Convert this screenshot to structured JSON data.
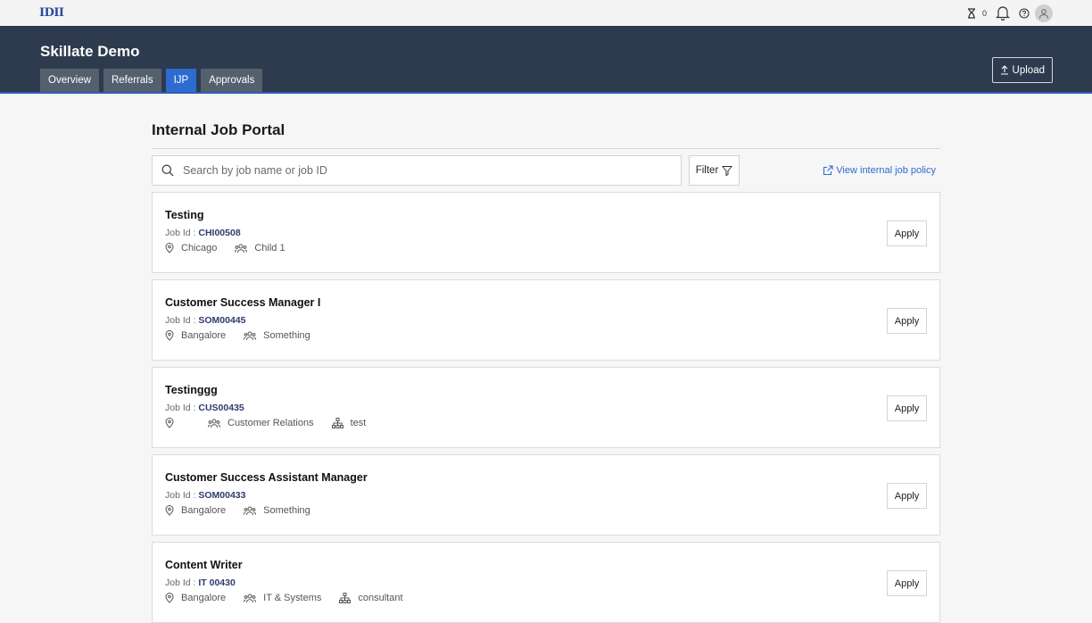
{
  "topbar": {
    "logo": "IDII",
    "pending_count": "0"
  },
  "header": {
    "title": "Skillate Demo",
    "tabs": [
      {
        "label": "Overview"
      },
      {
        "label": "Referrals"
      },
      {
        "label": "IJP"
      },
      {
        "label": "Approvals"
      }
    ],
    "upload_label": "Upload"
  },
  "main": {
    "title": "Internal Job Portal",
    "search_placeholder": "Search by job name or job ID",
    "filter_label": "Filter",
    "policy_link": "View internal job policy",
    "apply_label": "Apply",
    "job_id_prefix": "Job Id :",
    "jobs": [
      {
        "title": "Testing",
        "id": "CHI00508",
        "location": "Chicago",
        "department": "Child 1",
        "role": ""
      },
      {
        "title": "Customer Success Manager I",
        "id": "SOM00445",
        "location": "Bangalore",
        "department": "Something",
        "role": ""
      },
      {
        "title": "Testinggg",
        "id": "CUS00435",
        "location": "",
        "department": "Customer Relations",
        "role": "test"
      },
      {
        "title": "Customer Success Assistant Manager",
        "id": "SOM00433",
        "location": "Bangalore",
        "department": "Something",
        "role": ""
      },
      {
        "title": "Content Writer",
        "id": "IT 00430",
        "location": "Bangalore",
        "department": "IT & Systems",
        "role": "consultant"
      }
    ]
  },
  "colors": {
    "header_bg": "#2e3b4e",
    "active_tab": "#2e6bd1",
    "link": "#2e6bd1"
  }
}
